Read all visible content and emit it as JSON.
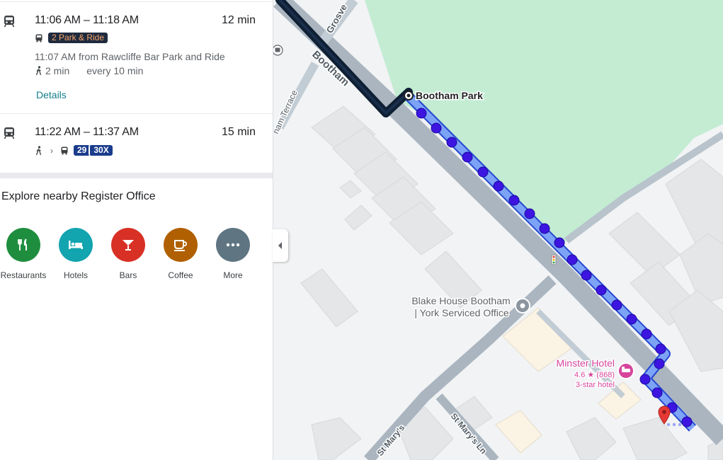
{
  "routes": [
    {
      "time_range": "11:06 AM – 11:18 AM",
      "duration": "12 min",
      "badge": "2 Park & Ride",
      "departure": "11:07 AM from Rawcliffe Bar Park and Ride",
      "walk": "2 min",
      "frequency": "every 10 min",
      "details_label": "Details"
    },
    {
      "time_range": "11:22 AM – 11:37 AM",
      "duration": "15 min",
      "badges": [
        "29",
        "30X"
      ]
    }
  ],
  "explore": {
    "title": "Explore nearby Register Office",
    "categories": [
      {
        "label": "Restaurants",
        "icon": "restaurant-icon",
        "color": "#1e8e3e"
      },
      {
        "label": "Hotels",
        "icon": "hotel-icon",
        "color": "#12a4af"
      },
      {
        "label": "Bars",
        "icon": "bar-icon",
        "color": "#d93025"
      },
      {
        "label": "Coffee",
        "icon": "coffee-icon",
        "color": "#b06000"
      },
      {
        "label": "More",
        "icon": "more-icon",
        "color": "#5f7582"
      }
    ]
  },
  "map": {
    "streets": {
      "bootham": "Bootham",
      "grosvenor": "Grosve",
      "terrace": "nam Terrace",
      "st_marys": "St Mary's",
      "st_marys_ln": "St Mary's Ln"
    },
    "places": {
      "bootham_park": "Bootham Park",
      "blake_house_line1": "Blake House Bootham",
      "blake_house_line2": "| York Serviced Office",
      "minster_hotel": "Minster Hotel",
      "minster_rating": "4.6 ★ (868)",
      "minster_class": "3-star hotel"
    },
    "colors": {
      "park": "#c3ecd3",
      "road": "#aab5c0",
      "route_dark": "#0f1f33",
      "walk_dot": "#3d15e0",
      "walk_line": "#6d8ef5",
      "hotel": "#d6459c",
      "destination": "#e53935"
    }
  }
}
